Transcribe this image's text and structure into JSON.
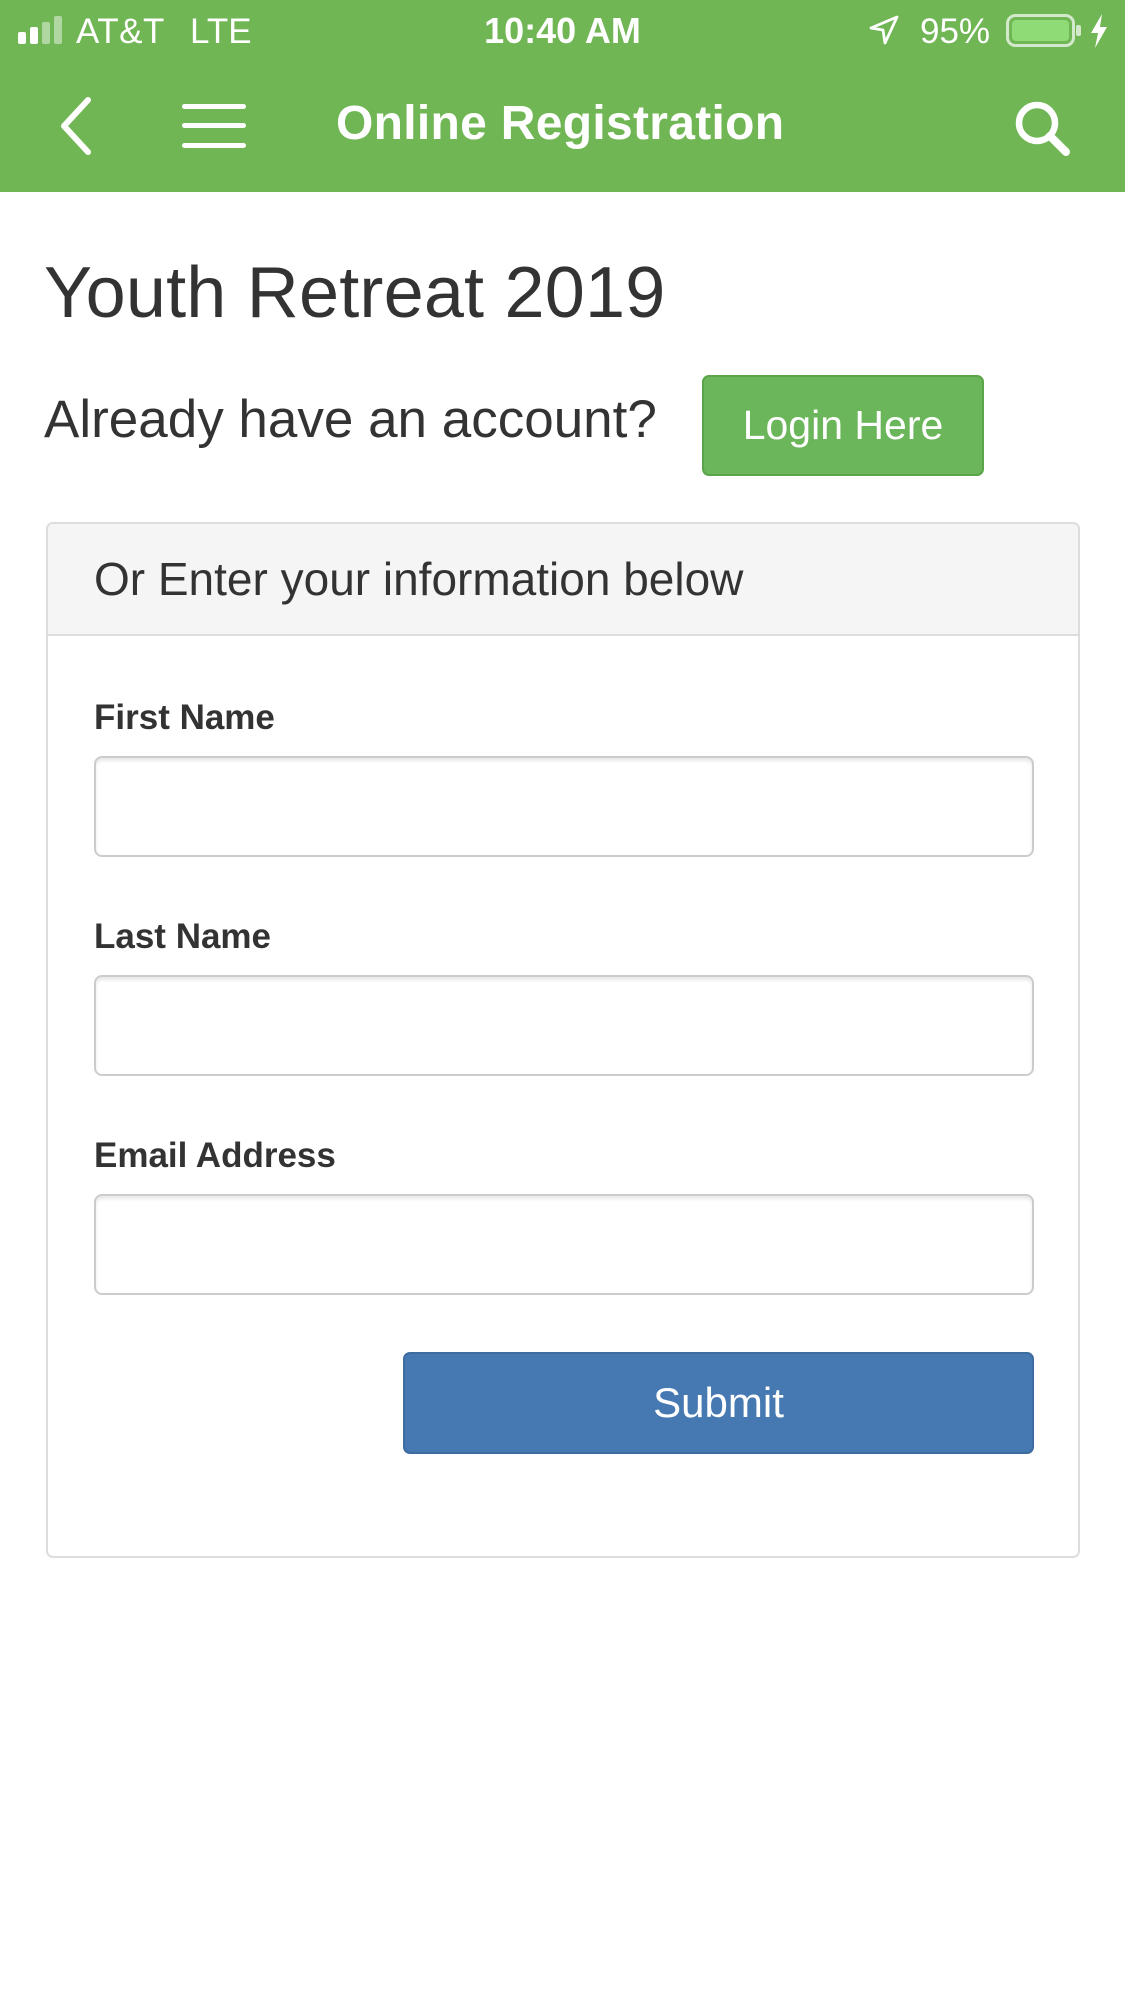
{
  "status_bar": {
    "carrier": "AT&T",
    "network": "LTE",
    "time": "10:40 AM",
    "battery": "95%",
    "battery_level": 0.95,
    "icons": [
      "signal-icon",
      "location-icon",
      "battery-icon",
      "charging-icon"
    ]
  },
  "nav": {
    "title": "Online Registration",
    "icons": [
      "back-chevron-icon",
      "hamburger-menu-icon",
      "search-icon"
    ]
  },
  "page": {
    "title": "Youth Retreat 2019",
    "account_prompt": "Already have an account?",
    "login_button": "Login Here"
  },
  "form": {
    "heading": "Or Enter your information below",
    "fields": [
      {
        "label": "First Name",
        "value": ""
      },
      {
        "label": "Last Name",
        "value": ""
      },
      {
        "label": "Email Address",
        "value": ""
      }
    ],
    "submit_button": "Submit"
  },
  "colors": {
    "header_green": "#70b655",
    "login_button_green": "#6bb65a",
    "submit_button_blue": "#4679b2",
    "text_dark": "#333333",
    "panel_heading_bg": "#f5f5f5"
  }
}
